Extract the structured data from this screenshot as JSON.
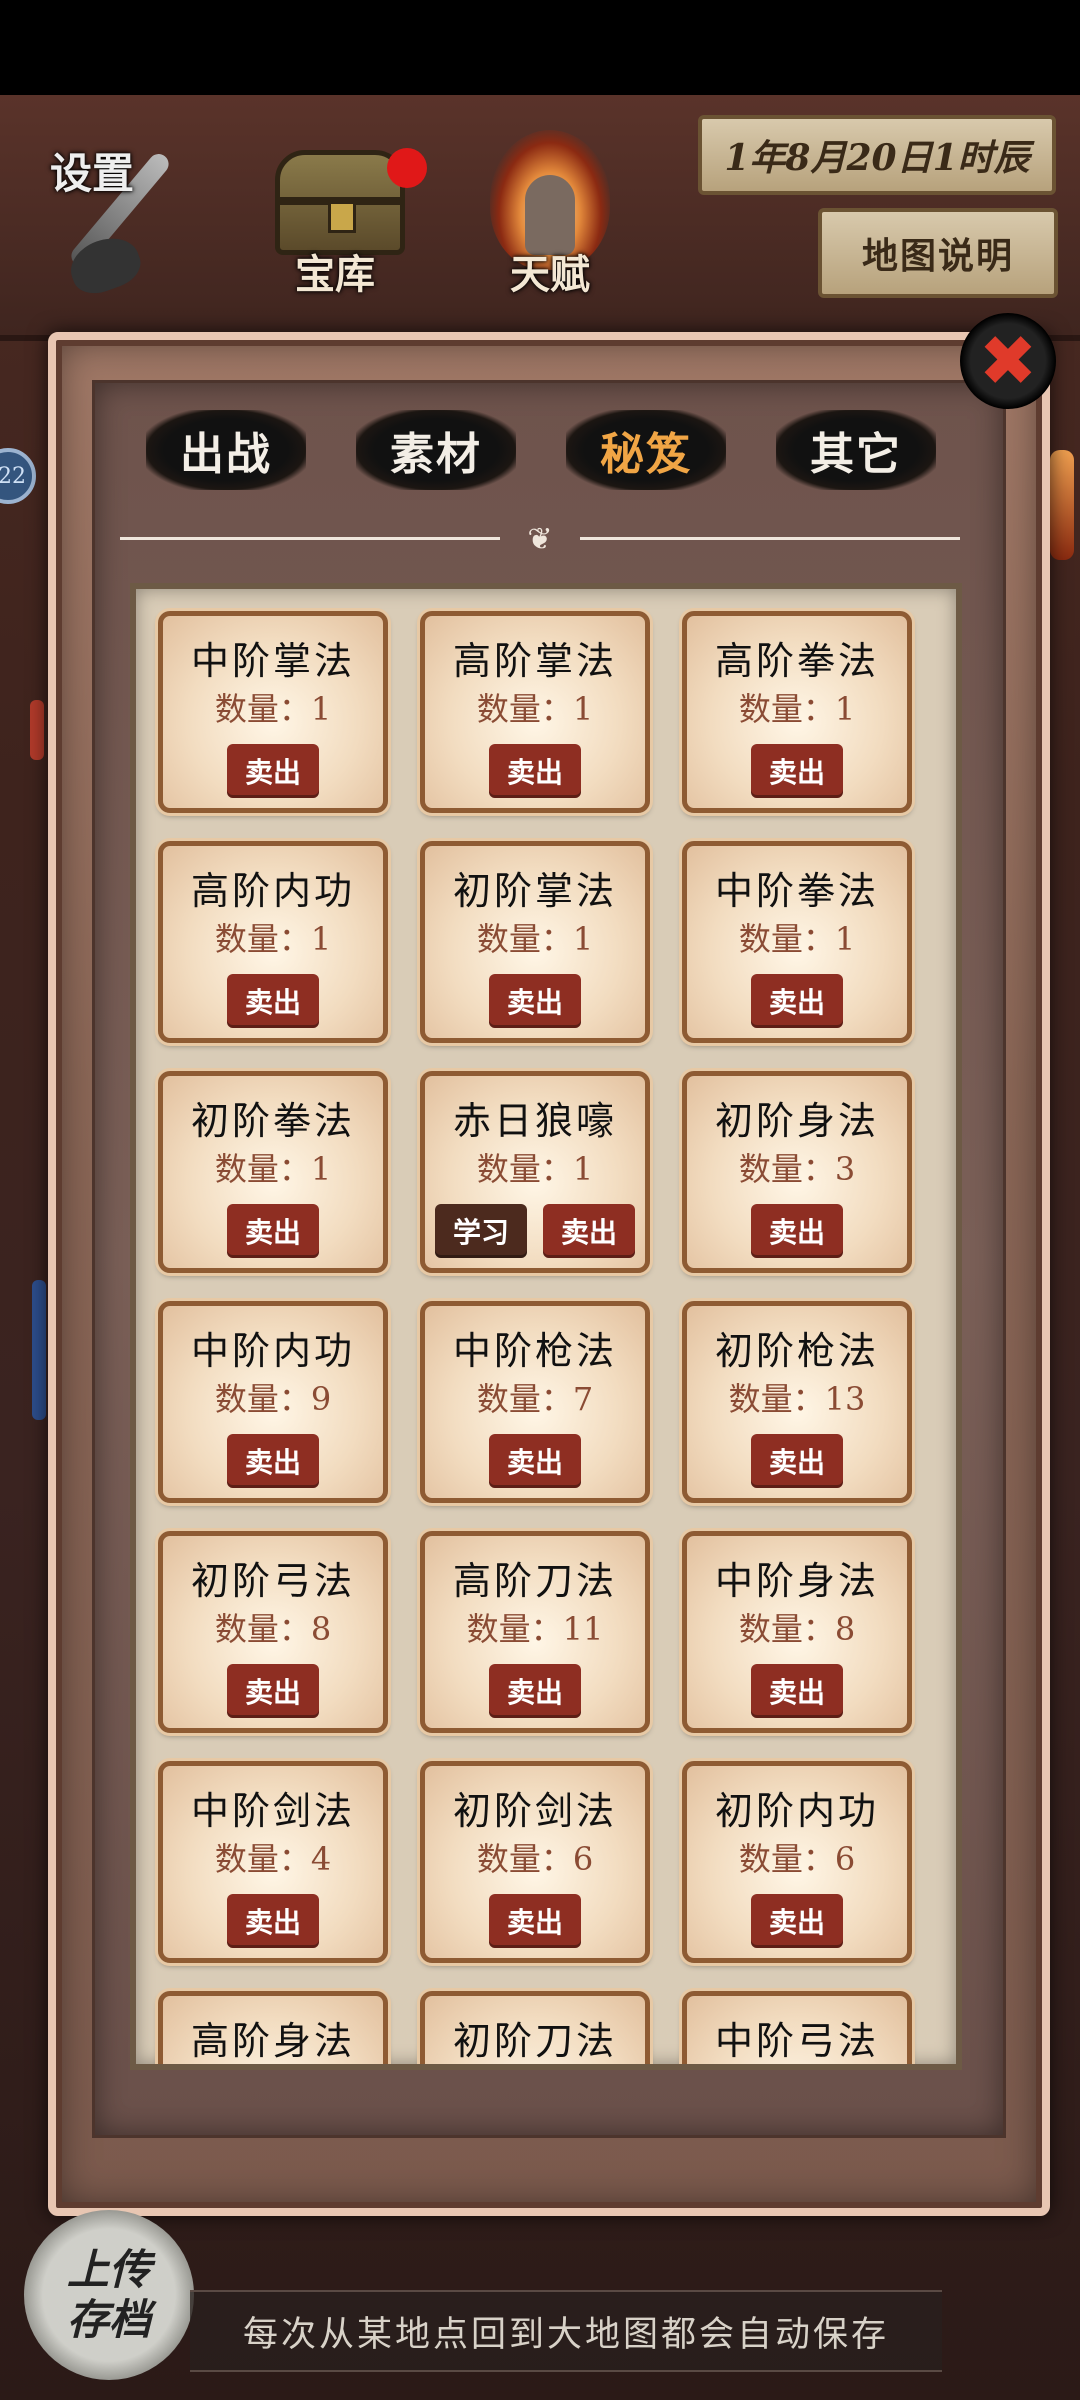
{
  "header": {
    "settings_label": "设置",
    "treasure_label": "宝库",
    "talent_label": "天赋",
    "date": "1年8月20日1时辰",
    "map_help": "地图说明"
  },
  "side": {
    "badge": "22"
  },
  "modal": {
    "close_icon": "✖",
    "tabs": [
      {
        "label": "出战"
      },
      {
        "label": "素材"
      },
      {
        "label": "秘笈"
      },
      {
        "label": "其它"
      }
    ],
    "active_tab": "秘笈",
    "items": [
      {
        "name": "中阶掌法",
        "qty": "数量：1",
        "sell": "卖出"
      },
      {
        "name": "高阶掌法",
        "qty": "数量：1",
        "sell": "卖出"
      },
      {
        "name": "高阶拳法",
        "qty": "数量：1",
        "sell": "卖出"
      },
      {
        "name": "高阶内功",
        "qty": "数量：1",
        "sell": "卖出"
      },
      {
        "name": "初阶掌法",
        "qty": "数量：1",
        "sell": "卖出"
      },
      {
        "name": "中阶拳法",
        "qty": "数量：1",
        "sell": "卖出"
      },
      {
        "name": "初阶拳法",
        "qty": "数量：1",
        "sell": "卖出"
      },
      {
        "name": "赤日狼嚎",
        "qty": "数量：1",
        "sell": "卖出",
        "learn": "学习"
      },
      {
        "name": "初阶身法",
        "qty": "数量：3",
        "sell": "卖出"
      },
      {
        "name": "中阶内功",
        "qty": "数量：9",
        "sell": "卖出"
      },
      {
        "name": "中阶枪法",
        "qty": "数量：7",
        "sell": "卖出"
      },
      {
        "name": "初阶枪法",
        "qty": "数量：13",
        "sell": "卖出"
      },
      {
        "name": "初阶弓法",
        "qty": "数量：8",
        "sell": "卖出"
      },
      {
        "name": "高阶刀法",
        "qty": "数量：11",
        "sell": "卖出"
      },
      {
        "name": "中阶身法",
        "qty": "数量：8",
        "sell": "卖出"
      },
      {
        "name": "中阶剑法",
        "qty": "数量：4",
        "sell": "卖出"
      },
      {
        "name": "初阶剑法",
        "qty": "数量：6",
        "sell": "卖出"
      },
      {
        "name": "初阶内功",
        "qty": "数量：6",
        "sell": "卖出"
      },
      {
        "name": "高阶身法",
        "qty": "",
        "sell": ""
      },
      {
        "name": "初阶刀法",
        "qty": "",
        "sell": ""
      },
      {
        "name": "中阶弓法",
        "qty": "",
        "sell": ""
      }
    ]
  },
  "footer": {
    "upload_line1": "上传",
    "upload_line2": "存档",
    "autosave_note": "每次从某地点回到大地图都会自动保存"
  }
}
